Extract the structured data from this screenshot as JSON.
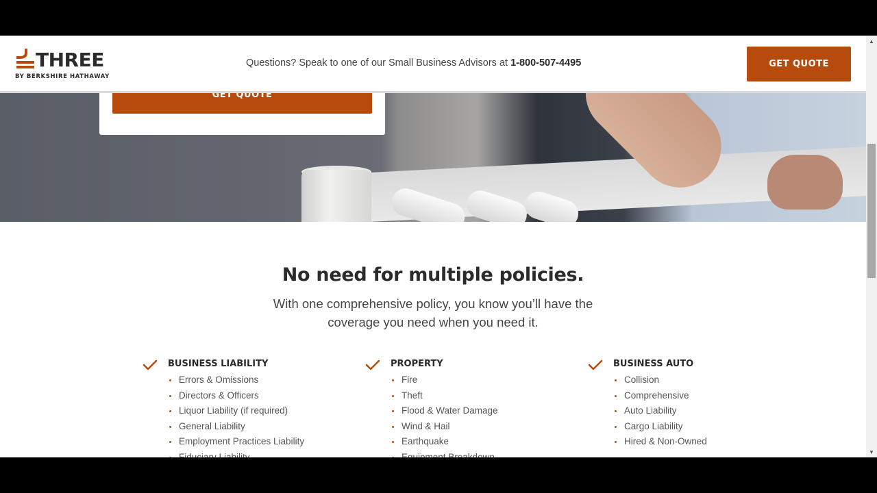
{
  "header": {
    "logo_word": "THREE",
    "logo_sub": "BY BERKSHIRE HATHAWAY",
    "message": "Questions? Speak to one of our Small Business Advisors at ",
    "phone": "1-800-507-4495",
    "cta_label": "GET QUOTE"
  },
  "hero": {
    "cta_label": "GET QUOTE"
  },
  "section": {
    "title": "No need for multiple policies.",
    "subtitle": "With one comprehensive policy, you know you’ll have the coverage you need when you need it."
  },
  "coverage": [
    {
      "title": "BUSINESS LIABILITY",
      "items": [
        "Errors & Omissions",
        "Directors & Officers",
        "Liquor Liability (if required)",
        "General Liability",
        "Employment Practices Liability",
        "Fiduciary Liability"
      ]
    },
    {
      "title": "PROPERTY",
      "items": [
        "Fire",
        "Theft",
        "Flood & Water Damage",
        "Wind & Hail",
        "Earthquake",
        "Equipment Breakdown"
      ]
    },
    {
      "title": "BUSINESS AUTO",
      "items": [
        "Collision",
        "Comprehensive",
        "Auto Liability",
        "Cargo Liability",
        "Hired & Non-Owned"
      ]
    }
  ],
  "colors": {
    "brand": "#b54c0e",
    "text_dark": "#2b2b2b"
  },
  "scrollbar": {
    "up_icon": "▲",
    "down_icon": "▼"
  }
}
